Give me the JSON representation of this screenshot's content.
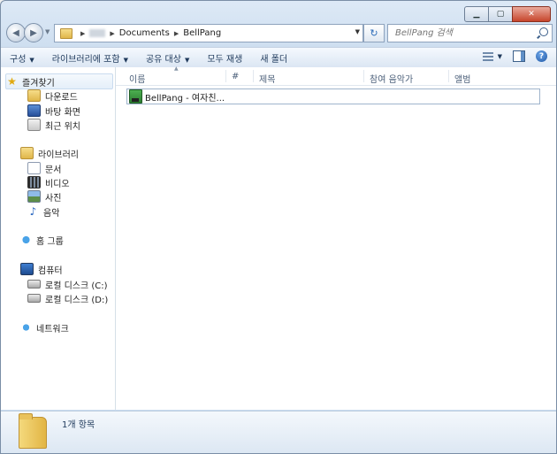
{
  "window": {
    "caption_buttons": {
      "minimize": "▁",
      "maximize": "▢",
      "close": "✕"
    }
  },
  "address": {
    "crumbs": [
      "Documents",
      "BellPang"
    ],
    "separator": "▶",
    "dropdown": "▼",
    "refresh": "↻"
  },
  "search": {
    "placeholder": "BellPang 검색"
  },
  "nav_buttons": {
    "back": "◀",
    "forward": "▶",
    "recent": "▼"
  },
  "toolbar": {
    "items": [
      {
        "label": "구성",
        "caret": "▼"
      },
      {
        "label": "라이브러리에 포함",
        "caret": "▼"
      },
      {
        "label": "공유 대상",
        "caret": "▼"
      },
      {
        "label": "모두 재생",
        "caret": ""
      },
      {
        "label": "새 폴더",
        "caret": ""
      }
    ],
    "view_caret": "▼",
    "help": "?"
  },
  "sidebar": {
    "favorites": {
      "label": "즐겨찾기",
      "icon": "★"
    },
    "favorites_items": [
      "다운로드",
      "바탕 화면",
      "최근 위치"
    ],
    "libraries": {
      "label": "라이브러리"
    },
    "libraries_items": [
      "문서",
      "비디오",
      "사진",
      "음악"
    ],
    "music_icon": "♪",
    "homegroup": {
      "label": "홈 그룹"
    },
    "computer": {
      "label": "컴퓨터"
    },
    "computer_items": [
      "로컬 디스크 (C:)",
      "로컬 디스크 (D:)"
    ],
    "network": {
      "label": "네트워크"
    }
  },
  "columns": {
    "sort_indicator": "▲",
    "headers": [
      "이름",
      "#",
      "제목",
      "참여 음악가",
      "앨범"
    ]
  },
  "files": [
    {
      "name": "BellPang - 여자친..."
    }
  ],
  "details": {
    "status": "1개 항목"
  }
}
